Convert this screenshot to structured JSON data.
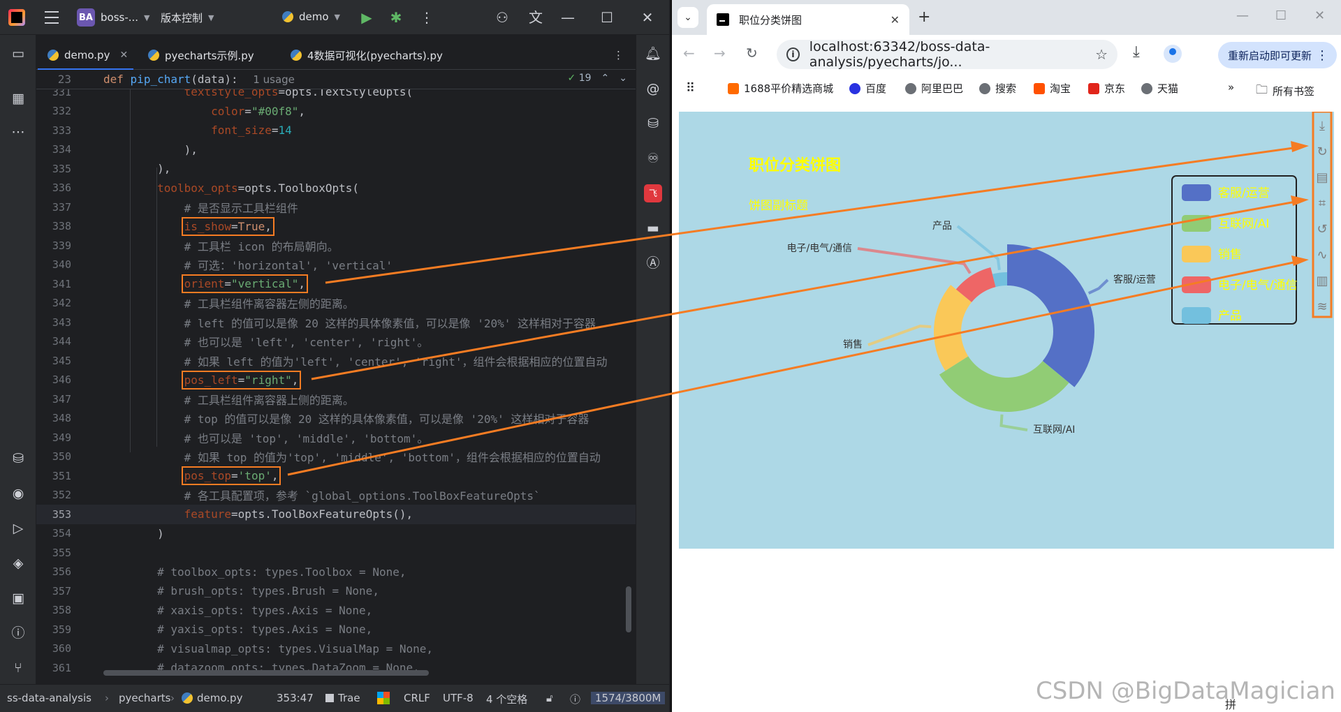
{
  "ide": {
    "project": {
      "badge": "BA",
      "name": "boss-..."
    },
    "vcs_label": "版本控制",
    "run_config": "demo",
    "tabs": [
      {
        "label": "demo.py",
        "active": true
      },
      {
        "label": "pyecharts示例.py",
        "active": false
      },
      {
        "label": "4数据可视化(pyecharts).py",
        "active": false
      }
    ],
    "sticky": {
      "line": "23",
      "def_kw": "def",
      "fn": "pip_chart",
      "args": "(data):",
      "usage": "1 usage",
      "inspections": "19"
    },
    "lines": [
      {
        "n": "331",
        "code": "            textstyle_opts=opts.TextStyleOpts("
      },
      {
        "n": "332",
        "code": "                color=\"#00f8\","
      },
      {
        "n": "333",
        "code": "                font_size=14"
      },
      {
        "n": "334",
        "code": "            ),"
      },
      {
        "n": "335",
        "code": "        ),"
      },
      {
        "n": "336",
        "code": "        toolbox_opts=opts.ToolboxOpts("
      },
      {
        "n": "337",
        "code": "            # 是否显示工具栏组件"
      },
      {
        "n": "338",
        "code": "            is_show=True,"
      },
      {
        "n": "339",
        "code": "            # 工具栏 icon 的布局朝向。"
      },
      {
        "n": "340",
        "code": "            # 可选：'horizontal', 'vertical'"
      },
      {
        "n": "341",
        "code": "            orient=\"vertical\","
      },
      {
        "n": "342",
        "code": "            # 工具栏组件离容器左侧的距离。"
      },
      {
        "n": "343",
        "code": "            # left 的值可以是像 20 这样的具体像素值，可以是像 '20%' 这样相对于容器"
      },
      {
        "n": "344",
        "code": "            # 也可以是 'left', 'center', 'right'。"
      },
      {
        "n": "345",
        "code": "            # 如果 left 的值为'left', 'center', 'right'，组件会根据相应的位置自动"
      },
      {
        "n": "346",
        "code": "            pos_left=\"right\","
      },
      {
        "n": "347",
        "code": "            # 工具栏组件离容器上侧的距离。"
      },
      {
        "n": "348",
        "code": "            # top 的值可以是像 20 这样的具体像素值，可以是像 '20%' 这样相对于容器"
      },
      {
        "n": "349",
        "code": "            # 也可以是 'top', 'middle', 'bottom'。"
      },
      {
        "n": "350",
        "code": "            # 如果 top 的值为'top', 'middle', 'bottom'，组件会根据相应的位置自动"
      },
      {
        "n": "351",
        "code": "            pos_top='top',"
      },
      {
        "n": "352",
        "code": "            # 各工具配置项，参考 `global_options.ToolBoxFeatureOpts`"
      },
      {
        "n": "353",
        "code": "            feature=opts.ToolBoxFeatureOpts(),"
      },
      {
        "n": "354",
        "code": "        )"
      },
      {
        "n": "355",
        "code": ""
      },
      {
        "n": "356",
        "code": "        # toolbox_opts: types.Toolbox = None,"
      },
      {
        "n": "357",
        "code": "        # brush_opts: types.Brush = None,"
      },
      {
        "n": "358",
        "code": "        # xaxis_opts: types.Axis = None,"
      },
      {
        "n": "359",
        "code": "        # yaxis_opts: types.Axis = None,"
      },
      {
        "n": "360",
        "code": "        # visualmap_opts: types.VisualMap = None,"
      },
      {
        "n": "361",
        "code": "        # datazoom_opts: types.DataZoom = None,"
      }
    ],
    "status": {
      "project": "ss-data-analysis",
      "folder": "pyecharts",
      "file": "demo.py",
      "position": "353:47",
      "indent_label": "Trae",
      "line_sep": "CRLF",
      "encoding": "UTF-8",
      "indent": "4 个空格",
      "memory": "1574/3800M"
    }
  },
  "browser": {
    "tab_title": "职位分类饼图",
    "url": "localhost:63342/boss-data-analysis/pyecharts/jo...",
    "update_label": "重新启动即可更新",
    "bookmarks": [
      "1688平价精选商城",
      "百度",
      "阿里巴巴",
      "搜索",
      "淘宝",
      "京东",
      "天猫"
    ],
    "bookmarks_all": "所有书签",
    "watermark": "CSDN @BigDataMagician",
    "ime": "拼"
  },
  "colors": {
    "accent_box": "#f57c23",
    "chart_bg": "#add8e6",
    "title_color": "#ffff00"
  },
  "chart_data": {
    "type": "pie",
    "subtype": "ring / rose",
    "title": "职位分类饼图",
    "subtitle": "饼图副标题",
    "legend_position": "right",
    "toolbox_orient": "vertical",
    "toolbox_position": "top-right",
    "categories": [
      "客服/运营",
      "互联网/AI",
      "销售",
      "电子/电气/通信",
      "产品"
    ],
    "values": [
      36,
      30,
      20,
      10,
      4
    ],
    "colors": [
      "#5470c6",
      "#91cc75",
      "#fac858",
      "#ee6666",
      "#73c0de"
    ],
    "label_color": "#333333",
    "legend_text_color": "#ffff00"
  }
}
